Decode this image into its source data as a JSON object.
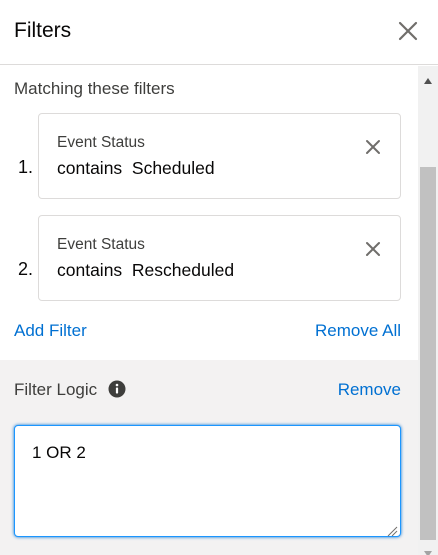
{
  "header": {
    "title": "Filters",
    "close_icon": "close-icon"
  },
  "filters": {
    "section_label": "Matching these filters",
    "items": [
      {
        "number": "1.",
        "field": "Event Status",
        "value": "contains  Scheduled"
      },
      {
        "number": "2.",
        "field": "Event Status",
        "value": "contains  Rescheduled"
      }
    ],
    "add_filter_label": "Add Filter",
    "remove_all_label": "Remove All"
  },
  "filter_logic": {
    "label": "Filter Logic",
    "info_icon": "info-icon",
    "remove_label": "Remove",
    "value": "1 OR 2"
  },
  "colors": {
    "link": "#0070d2",
    "logic_background": "#f3f2f2",
    "input_focus_border": "#1b96ff"
  }
}
